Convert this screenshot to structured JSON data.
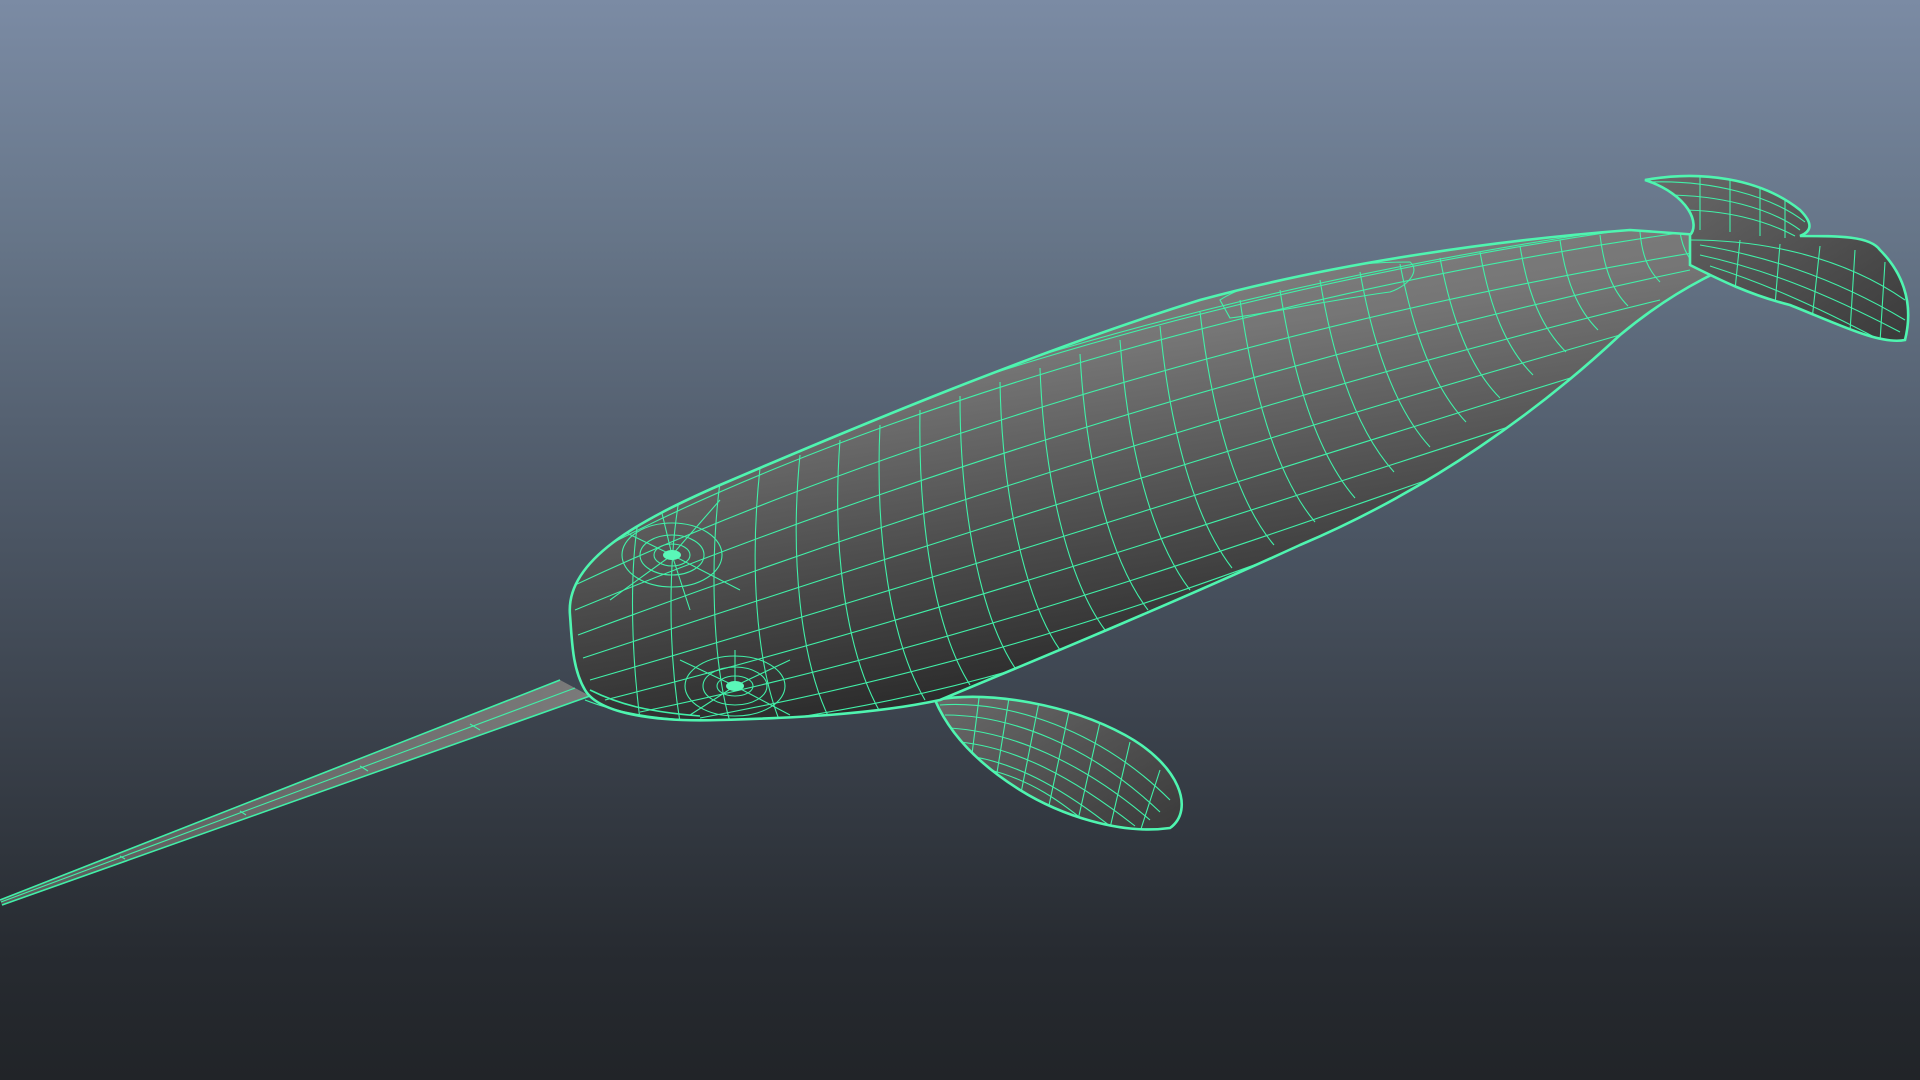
{
  "viewport": {
    "background_top": "#7b8ba4",
    "background_bottom": "#212428",
    "wireframe_color": "#41f0a8",
    "surface_color": "#707070"
  },
  "model": {
    "subject": "narwhal",
    "display_mode": "wireframe-on-shaded"
  }
}
